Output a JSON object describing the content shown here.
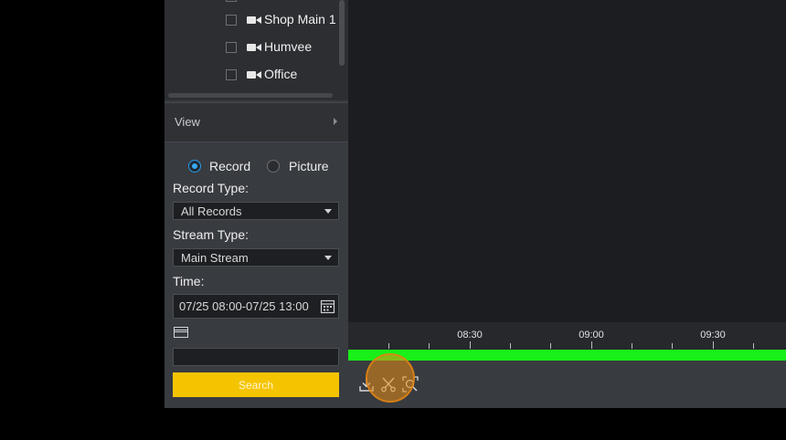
{
  "devices": [
    {
      "label": "Shop Main 1",
      "checked": false
    },
    {
      "label": "Humvee",
      "checked": false
    },
    {
      "label": "Office",
      "checked": false
    }
  ],
  "view": {
    "label": "View"
  },
  "search_panel": {
    "radio_record": "Record",
    "radio_picture": "Picture",
    "selected_mode": "Record",
    "record_type_label": "Record Type:",
    "record_type_value": "All Records",
    "stream_type_label": "Stream Type:",
    "stream_type_value": "Main Stream",
    "time_label": "Time:",
    "time_value": "07/25 08:00-07/25 13:00",
    "card_input_value": "",
    "search_button": "Search"
  },
  "timeline": {
    "ticks": [
      "08:30",
      "09:00",
      "09:30"
    ],
    "bar_color": "#19f019"
  },
  "toolbar": {
    "icons": [
      "download-icon",
      "scissors-icon",
      "zoom-frame-icon"
    ]
  },
  "colors": {
    "accent": "#f5c400",
    "radio_selected": "#2b9be8"
  }
}
